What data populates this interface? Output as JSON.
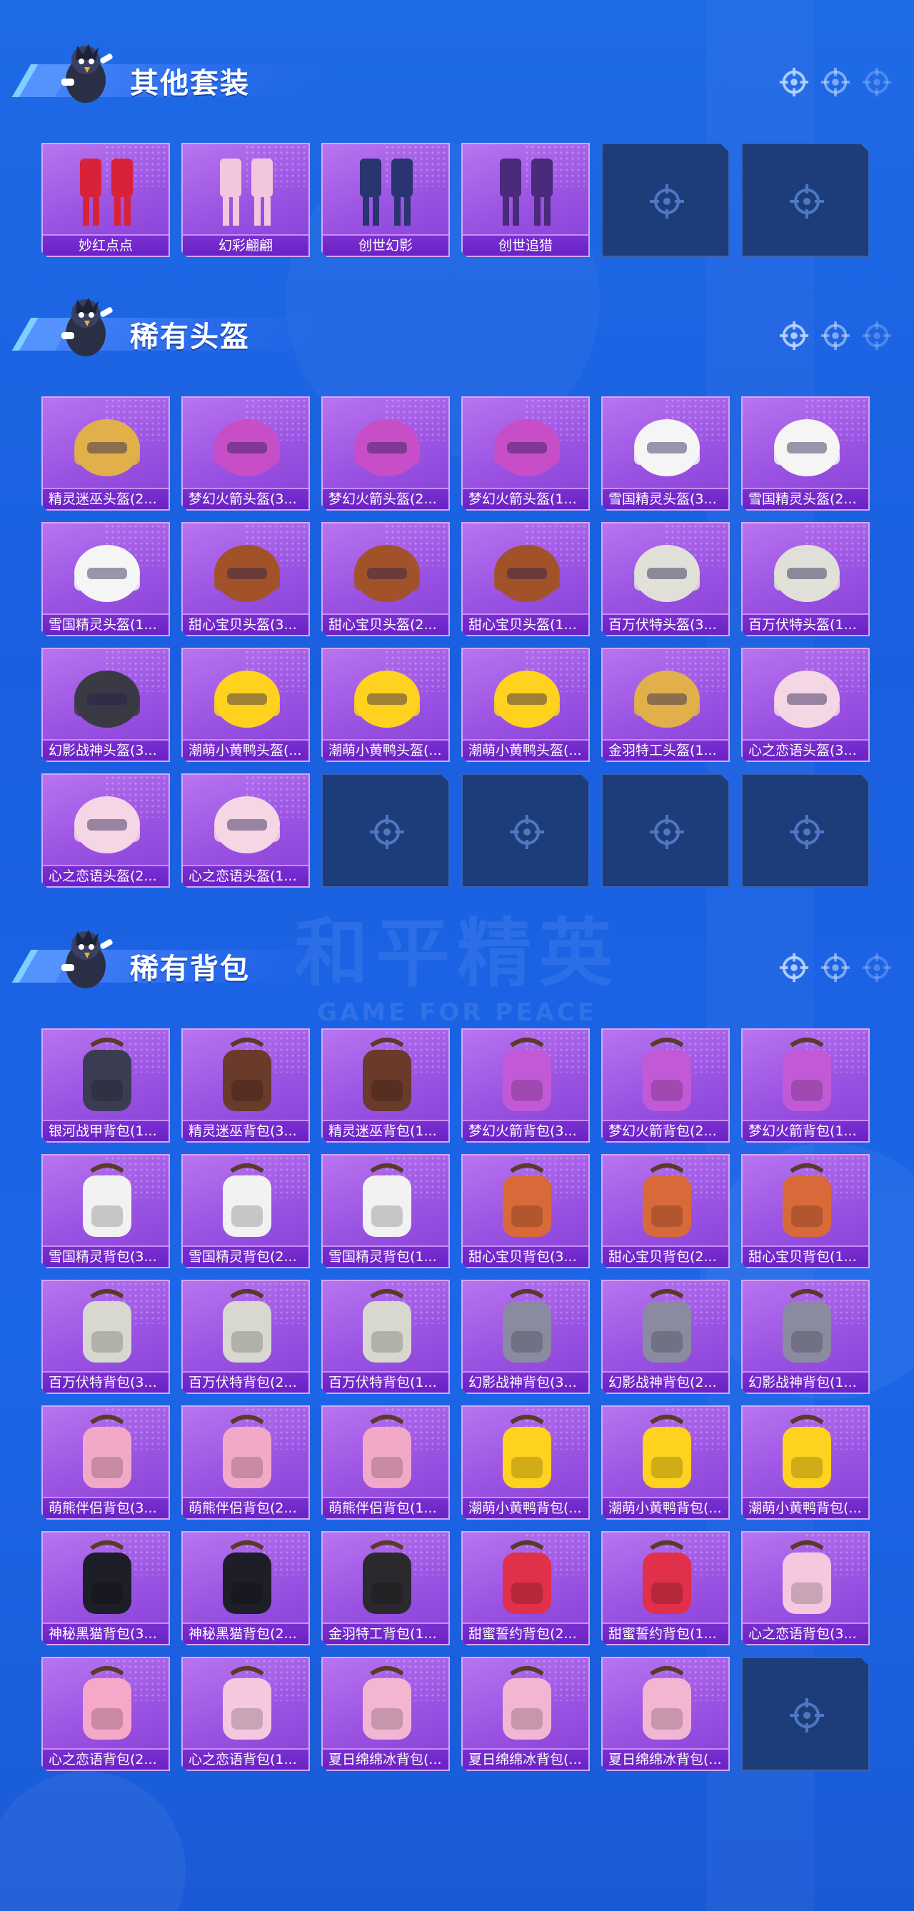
{
  "colors": {
    "background": "#1c63e4",
    "card_purple": "#9a52e2",
    "label_purple": "#6a22c6",
    "empty_slot": "#1d3d7a"
  },
  "watermark": {
    "title": "和平精英",
    "subtitle": "GAME FOR PEACE"
  },
  "sections": [
    {
      "title": "其他套装",
      "items": [
        {
          "label": "妙红点点",
          "icon": "red-dress-outfit-icon"
        },
        {
          "label": "幻彩翩翩",
          "icon": "pastel-outfit-icon"
        },
        {
          "label": "创世幻影",
          "icon": "blue-armor-suit-icon"
        },
        {
          "label": "创世追猎",
          "icon": "purple-armor-suit-icon"
        },
        {
          "label": "",
          "empty": true
        },
        {
          "label": "",
          "empty": true
        }
      ]
    },
    {
      "title": "稀有头盔",
      "items": [
        {
          "label": "精灵迷巫头盔(2...",
          "icon": "gold-winged-helmet-icon"
        },
        {
          "label": "梦幻火箭头盔(3...",
          "icon": "rocket-helmet-icon"
        },
        {
          "label": "梦幻火箭头盔(2...",
          "icon": "rocket-helmet-icon"
        },
        {
          "label": "梦幻火箭头盔(1...",
          "icon": "rocket-helmet-icon"
        },
        {
          "label": "雪国精灵头盔(3...",
          "icon": "snowman-helmet-icon"
        },
        {
          "label": "雪国精灵头盔(2...",
          "icon": "snowman-helmet-icon"
        },
        {
          "label": "雪国精灵头盔(1...",
          "icon": "snowman-helmet-icon"
        },
        {
          "label": "甜心宝贝头盔(3...",
          "icon": "sweet-cake-helmet-icon"
        },
        {
          "label": "甜心宝贝头盔(2...",
          "icon": "sweet-cake-helmet-icon"
        },
        {
          "label": "甜心宝贝头盔(1...",
          "icon": "sweet-cake-helmet-icon"
        },
        {
          "label": "百万伏特头盔(3...",
          "icon": "volt-helmet-icon"
        },
        {
          "label": "百万伏特头盔(1...",
          "icon": "volt-helmet-icon"
        },
        {
          "label": "幻影战神头盔(3...",
          "icon": "phantom-helmet-icon"
        },
        {
          "label": "潮萌小黄鸭头盔(...",
          "icon": "duck-helmet-icon"
        },
        {
          "label": "潮萌小黄鸭头盔(...",
          "icon": "duck-helmet-icon"
        },
        {
          "label": "潮萌小黄鸭头盔(...",
          "icon": "duck-helmet-icon"
        },
        {
          "label": "金羽特工头盔(1...",
          "icon": "black-gold-helmet-icon"
        },
        {
          "label": "心之恋语头盔(3...",
          "icon": "heart-helmet-icon"
        },
        {
          "label": "心之恋语头盔(2...",
          "icon": "heart-helmet-icon"
        },
        {
          "label": "心之恋语头盔(1...",
          "icon": "heart-helmet-icon"
        },
        {
          "label": "",
          "empty": true
        },
        {
          "label": "",
          "empty": true
        },
        {
          "label": "",
          "empty": true
        },
        {
          "label": "",
          "empty": true
        }
      ]
    },
    {
      "title": "稀有背包",
      "items": [
        {
          "label": "银河战甲背包(1...",
          "icon": "galaxy-backpack-icon"
        },
        {
          "label": "精灵迷巫背包(3...",
          "icon": "treasure-chest-backpack-icon"
        },
        {
          "label": "精灵迷巫背包(1...",
          "icon": "treasure-chest-backpack-icon"
        },
        {
          "label": "梦幻火箭背包(3...",
          "icon": "rocket-backpack-icon"
        },
        {
          "label": "梦幻火箭背包(2...",
          "icon": "rocket-backpack-icon"
        },
        {
          "label": "梦幻火箭背包(1...",
          "icon": "rocket-backpack-icon"
        },
        {
          "label": "雪国精灵背包(3...",
          "icon": "snowman-backpack-icon"
        },
        {
          "label": "雪国精灵背包(2...",
          "icon": "snowman-backpack-icon"
        },
        {
          "label": "雪国精灵背包(1...",
          "icon": "snowman-backpack-icon"
        },
        {
          "label": "甜心宝贝背包(3...",
          "icon": "cake-backpack-icon"
        },
        {
          "label": "甜心宝贝背包(2...",
          "icon": "cake-backpack-icon"
        },
        {
          "label": "甜心宝贝背包(1...",
          "icon": "cake-backpack-icon"
        },
        {
          "label": "百万伏特背包(3...",
          "icon": "volt-backpack-icon"
        },
        {
          "label": "百万伏特背包(2...",
          "icon": "volt-backpack-icon"
        },
        {
          "label": "百万伏特背包(1...",
          "icon": "volt-backpack-icon"
        },
        {
          "label": "幻影战神背包(3...",
          "icon": "phantom-backpack-icon"
        },
        {
          "label": "幻影战神背包(2...",
          "icon": "phantom-backpack-icon"
        },
        {
          "label": "幻影战神背包(1...",
          "icon": "phantom-backpack-icon"
        },
        {
          "label": "萌熊伴侣背包(3...",
          "icon": "bear-backpack-icon"
        },
        {
          "label": "萌熊伴侣背包(2...",
          "icon": "bear-backpack-icon"
        },
        {
          "label": "萌熊伴侣背包(1...",
          "icon": "bear-backpack-icon"
        },
        {
          "label": "潮萌小黄鸭背包(...",
          "icon": "duck-backpack-icon"
        },
        {
          "label": "潮萌小黄鸭背包(...",
          "icon": "duck-backpack-icon"
        },
        {
          "label": "潮萌小黄鸭背包(...",
          "icon": "duck-backpack-icon"
        },
        {
          "label": "神秘黑猫背包(3...",
          "icon": "black-cat-backpack-icon"
        },
        {
          "label": "神秘黑猫背包(2...",
          "icon": "black-cat-backpack-icon"
        },
        {
          "label": "金羽特工背包(1...",
          "icon": "black-gold-backpack-icon"
        },
        {
          "label": "甜蜜誓约背包(2...",
          "icon": "red-bow-backpack-icon"
        },
        {
          "label": "甜蜜誓约背包(1...",
          "icon": "red-bow-backpack-icon"
        },
        {
          "label": "心之恋语背包(3...",
          "icon": "star-backpack-icon"
        },
        {
          "label": "心之恋语背包(2...",
          "icon": "heart-backpack-icon"
        },
        {
          "label": "心之恋语背包(1...",
          "icon": "star-backpack-icon"
        },
        {
          "label": "夏日绵绵冰背包(...",
          "icon": "icecream-backpack-icon"
        },
        {
          "label": "夏日绵绵冰背包(...",
          "icon": "icecream-backpack-icon"
        },
        {
          "label": "夏日绵绵冰背包(...",
          "icon": "icecream-backpack-icon"
        },
        {
          "label": "",
          "empty": true
        }
      ]
    }
  ]
}
